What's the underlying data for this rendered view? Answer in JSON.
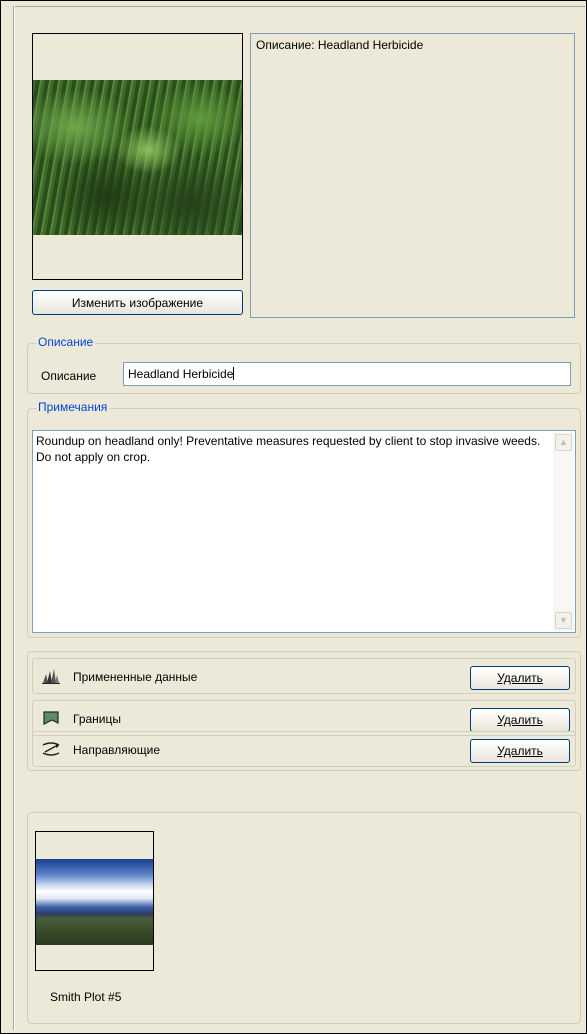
{
  "preview": {
    "change_image_label": "Изменить изображение"
  },
  "description_box": {
    "text": "Описание: Headland Herbicide"
  },
  "description_group": {
    "legend": "Описание",
    "label": "Описание",
    "value": "Headland Herbicide"
  },
  "notes_group": {
    "legend": "Примечания",
    "value": "Roundup on headland only!  Preventative measures requested by client to stop invasive weeds.  Do not apply on crop."
  },
  "layers": [
    {
      "label": "Примененные данные",
      "icon": "applied-data-icon",
      "delete_label": "Удалить"
    },
    {
      "label": "Границы",
      "icon": "boundary-icon",
      "delete_label": "Удалить"
    },
    {
      "label": "Направляющие",
      "icon": "guidance-icon",
      "delete_label": "Удалить"
    }
  ],
  "photos": [
    {
      "label": "Smith Plot #5"
    }
  ]
}
